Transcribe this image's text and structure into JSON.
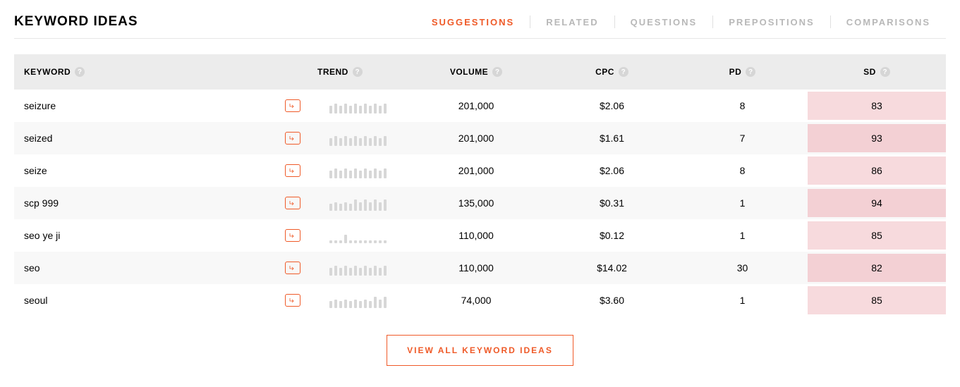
{
  "header": {
    "title": "KEYWORD IDEAS",
    "tabs": [
      "SUGGESTIONS",
      "RELATED",
      "QUESTIONS",
      "PREPOSITIONS",
      "COMPARISONS"
    ],
    "active_tab_index": 0
  },
  "columns": {
    "keyword": "KEYWORD",
    "trend": "TREND",
    "volume": "VOLUME",
    "cpc": "CPC",
    "pd": "PD",
    "sd": "SD"
  },
  "rows": [
    {
      "keyword": "seizure",
      "trend": [
        11,
        14,
        11,
        14,
        11,
        14,
        11,
        14,
        11,
        14,
        11,
        14
      ],
      "volume": "201,000",
      "cpc": "$2.06",
      "pd": "8",
      "sd": "83"
    },
    {
      "keyword": "seized",
      "trend": [
        11,
        14,
        11,
        14,
        11,
        14,
        11,
        14,
        11,
        14,
        11,
        14
      ],
      "volume": "201,000",
      "cpc": "$1.61",
      "pd": "7",
      "sd": "93"
    },
    {
      "keyword": "seize",
      "trend": [
        11,
        14,
        11,
        14,
        11,
        14,
        11,
        14,
        11,
        14,
        11,
        14
      ],
      "volume": "201,000",
      "cpc": "$2.06",
      "pd": "8",
      "sd": "86"
    },
    {
      "keyword": "scp 999",
      "trend": [
        10,
        12,
        10,
        12,
        10,
        16,
        12,
        16,
        12,
        16,
        12,
        16
      ],
      "volume": "135,000",
      "cpc": "$0.31",
      "pd": "1",
      "sd": "94"
    },
    {
      "keyword": "seo ye ji",
      "trend": [
        4,
        4,
        4,
        12,
        4,
        4,
        4,
        4,
        4,
        4,
        4,
        4
      ],
      "volume": "110,000",
      "cpc": "$0.12",
      "pd": "1",
      "sd": "85"
    },
    {
      "keyword": "seo",
      "trend": [
        11,
        14,
        11,
        14,
        11,
        14,
        11,
        14,
        11,
        14,
        11,
        14
      ],
      "volume": "110,000",
      "cpc": "$14.02",
      "pd": "30",
      "sd": "82"
    },
    {
      "keyword": "seoul",
      "trend": [
        10,
        12,
        10,
        12,
        10,
        12,
        10,
        12,
        10,
        16,
        12,
        16
      ],
      "volume": "74,000",
      "cpc": "$3.60",
      "pd": "1",
      "sd": "85"
    }
  ],
  "footer": {
    "view_all": "VIEW ALL KEYWORD IDEAS"
  },
  "colors": {
    "accent": "#ef5a28",
    "sd_bg": "#f7dadd"
  },
  "icons": {
    "info_glyph": "?"
  }
}
